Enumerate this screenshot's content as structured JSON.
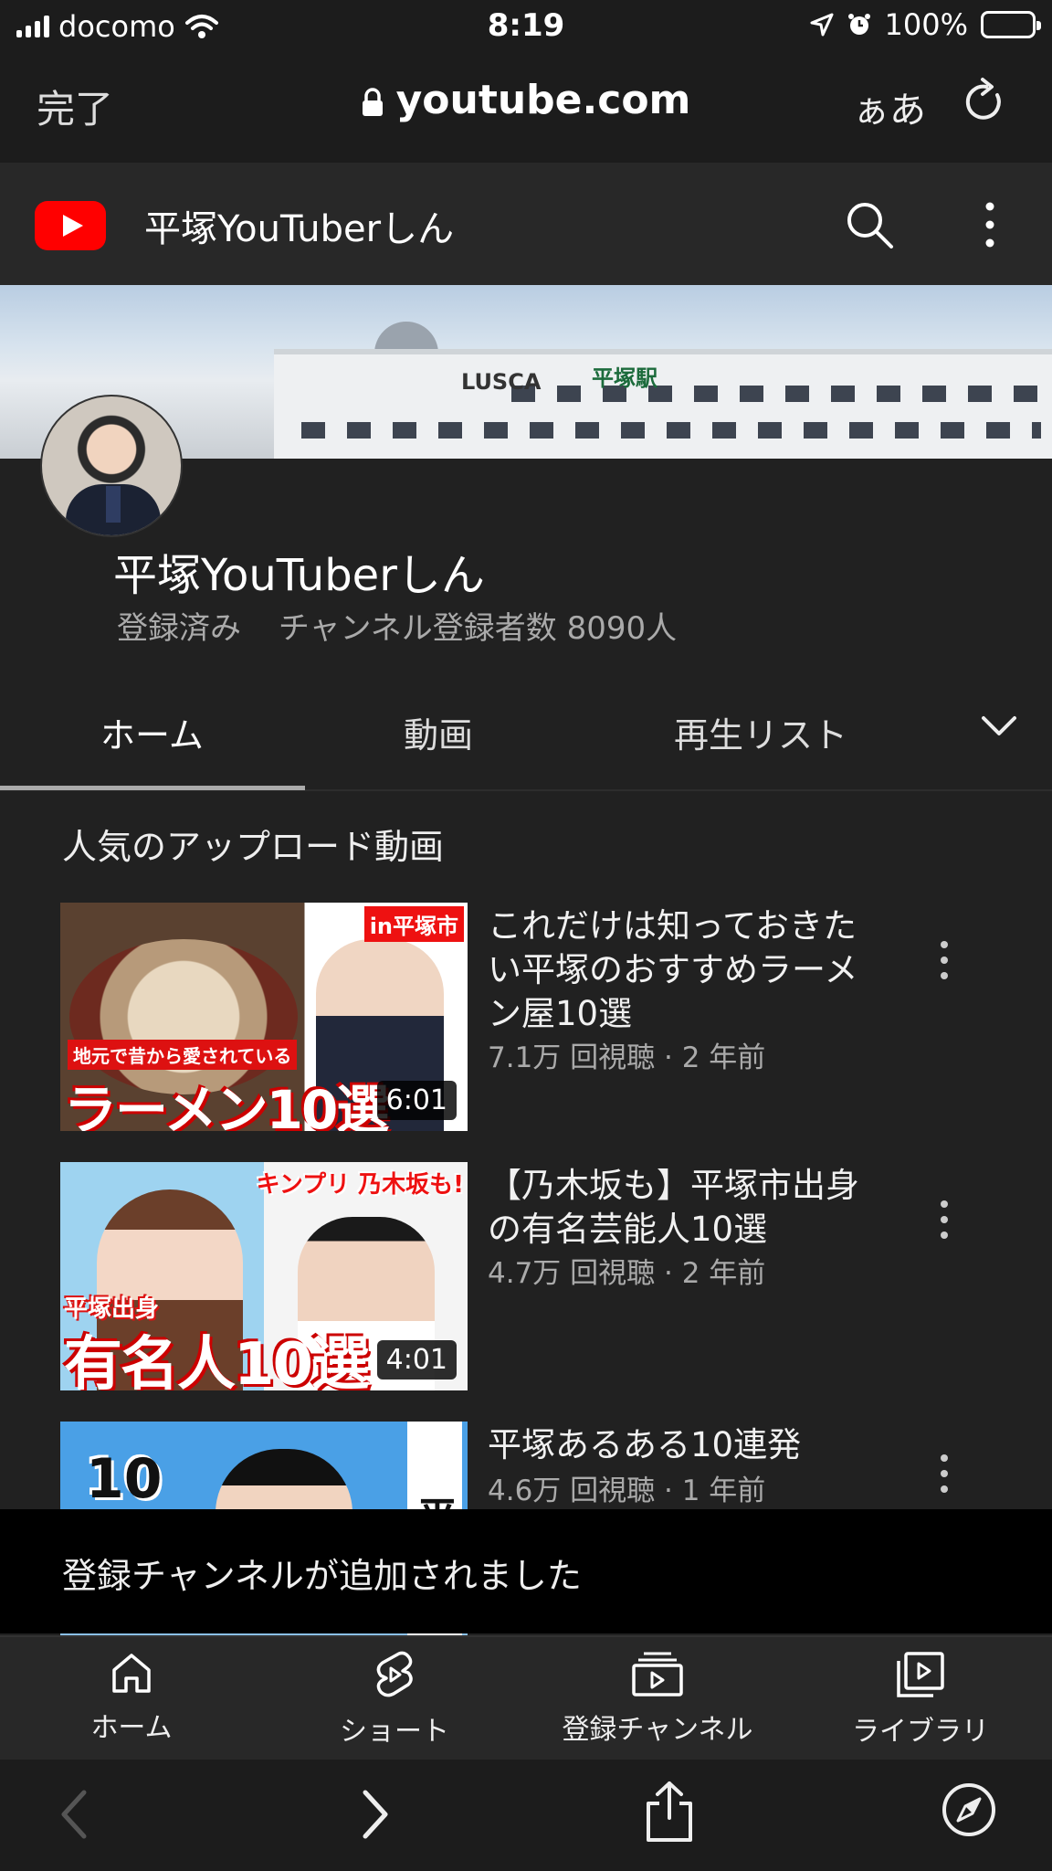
{
  "status_bar": {
    "carrier": "docomo",
    "time": "8:19",
    "battery": "100%"
  },
  "safari": {
    "done_label": "完了",
    "url": "youtube.com",
    "text_size_label": "ぁあ"
  },
  "yt_header": {
    "title": "平塚YouTuberしん"
  },
  "channel": {
    "name": "平塚YouTuberしん",
    "subscribed_label": "登録済み",
    "subscriber_count": "チャンネル登録者数 8090人"
  },
  "tabs": [
    {
      "label": "ホーム",
      "active": true
    },
    {
      "label": "動画"
    },
    {
      "label": "再生リスト"
    }
  ],
  "section": {
    "title": "人気のアップロード動画"
  },
  "videos": [
    {
      "title": "これだけは知っておきたい平塚のおすすめラーメン屋10選",
      "meta": "7.1万 回視聴 · 2 年前",
      "duration": "6:01",
      "thumb_tag": "in平塚市",
      "thumb_caption_small": "地元で昔から愛されている",
      "thumb_caption_big": "ラーメン10選"
    },
    {
      "title": "【乃木坂も】平塚市出身の有名芸能人10選",
      "meta": "4.7万 回視聴 · 2 年前",
      "duration": "4:01",
      "thumb_tag": "キンプリ 乃木坂も!",
      "thumb_caption_small": "平塚出身",
      "thumb_caption_big": "有名人10選"
    },
    {
      "title": "平塚あるある10連発",
      "meta": "4.6万 回視聴 · 1 年前",
      "thumb_big": "10",
      "thumb_vert": "平塚"
    }
  ],
  "toast": {
    "message": "登録チャンネルが追加されました"
  },
  "bottom_nav": [
    {
      "label": "ホーム",
      "icon": "home-icon"
    },
    {
      "label": "ショート",
      "icon": "shorts-icon"
    },
    {
      "label": "登録チャンネル",
      "icon": "subscriptions-icon"
    },
    {
      "label": "ライブラリ",
      "icon": "library-icon"
    }
  ],
  "banner_signs": {
    "mall": "LUSCA",
    "station": "平塚駅"
  },
  "colors": {
    "youtube_red": "#ff0000",
    "background": "#212121",
    "battery_green": "#34c759"
  }
}
